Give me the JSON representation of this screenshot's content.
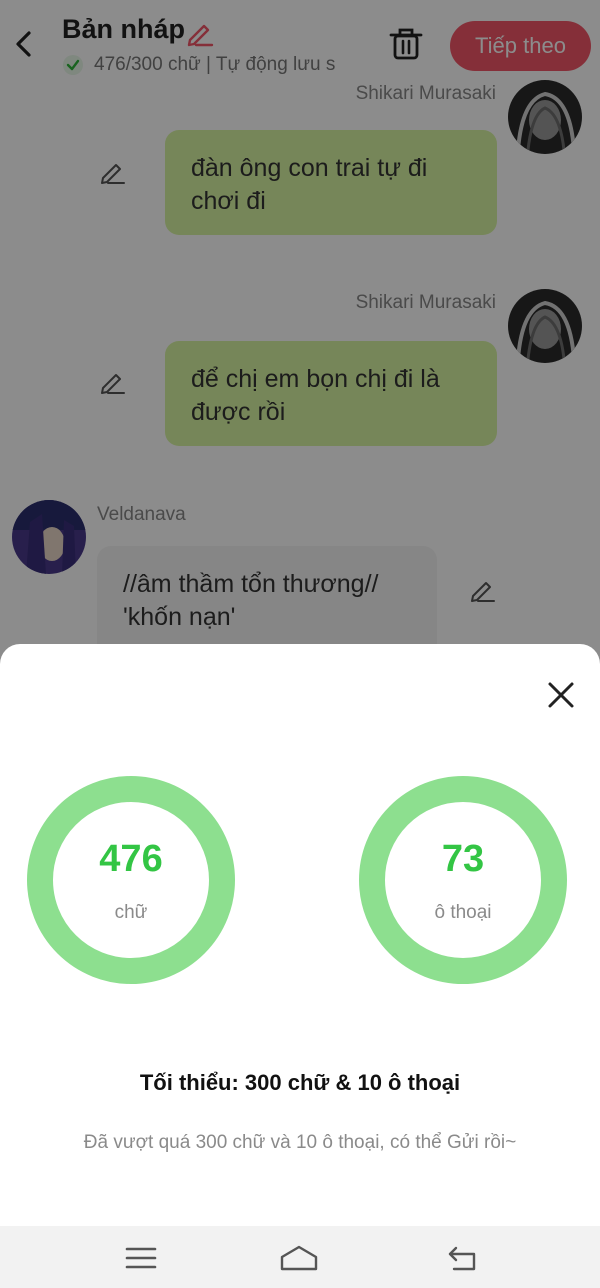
{
  "header": {
    "title": "Bản nháp",
    "status": "476/300 chữ | Tự động lưu s",
    "next_label": "Tiếp theo"
  },
  "messages": [
    {
      "speaker": "Shikari Murasaki",
      "text": "đàn ông con trai tự đi chơi đi"
    },
    {
      "speaker": "Shikari Murasaki",
      "text": "để chị em bọn chị đi là được rồi"
    },
    {
      "speaker": "Veldanava",
      "text": "//âm thầm tổn thương// 'khốn nạn'"
    }
  ],
  "stats": {
    "words": {
      "value": "476",
      "label": "chữ"
    },
    "dialogs": {
      "value": "73",
      "label": "ô thoại"
    },
    "minimum": "Tối thiểu: 300 chữ & 10 ô thoại",
    "hint": "Đã vượt quá 300 chữ và 10 ô thoại, có thể Gửi rồi~"
  },
  "colors": {
    "accent": "#f25768",
    "ring": "#8ddf8f",
    "ring_number": "#33c544",
    "bubble_right": "#d8f5a2",
    "bubble_left": "#f4f4f4"
  },
  "icons": [
    "back-icon",
    "edit-icon",
    "check-icon",
    "trash-icon",
    "close-icon",
    "menu-icon",
    "home-icon",
    "return-icon"
  ]
}
